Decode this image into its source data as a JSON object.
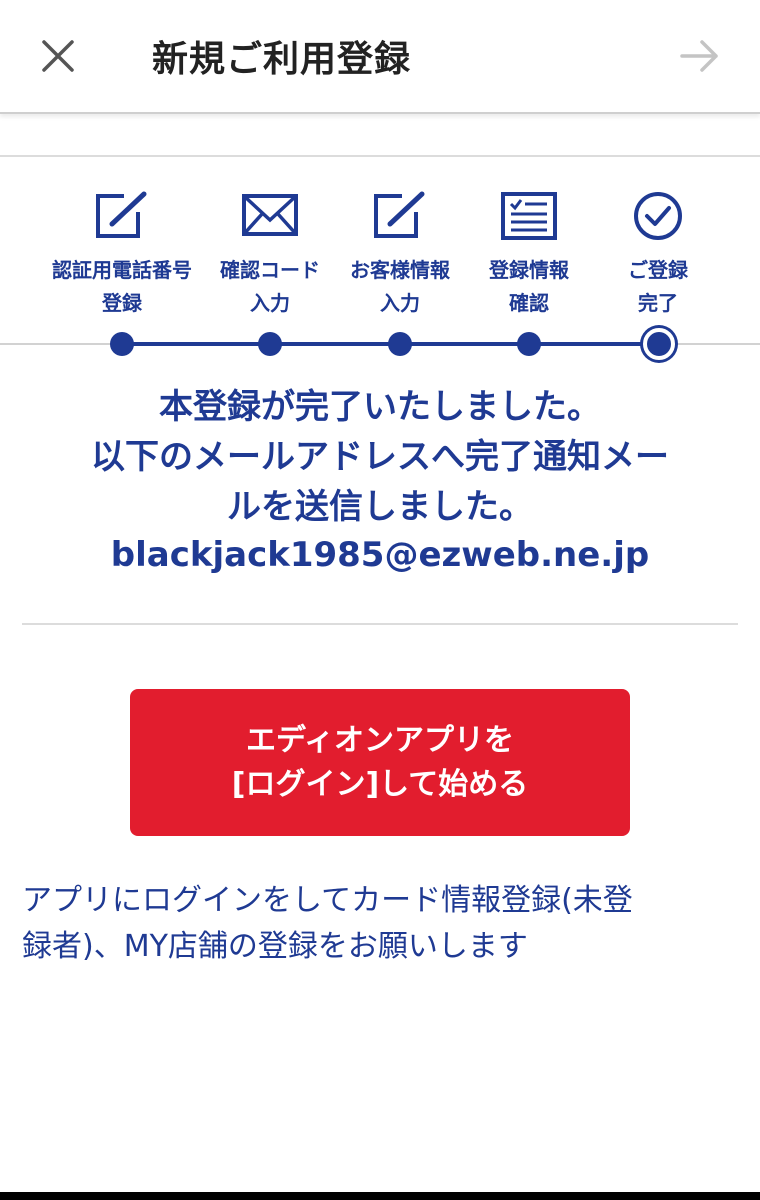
{
  "header": {
    "title": "新規ご利用登録",
    "close_icon": "close-icon",
    "next_icon": "arrow-right-icon"
  },
  "steps": [
    {
      "icon": "edit-icon",
      "line1": "認証用電話番号",
      "line2": "登録"
    },
    {
      "icon": "mail-icon",
      "line1": "確認コード",
      "line2": "入力"
    },
    {
      "icon": "edit-icon",
      "line1": "お客様情報",
      "line2": "入力"
    },
    {
      "icon": "form-icon",
      "line1": "登録情報",
      "line2": "確認"
    },
    {
      "icon": "check-circle-icon",
      "line1": "ご登録",
      "line2": "完了"
    }
  ],
  "current_step": 5,
  "message": {
    "line1": "本登録が完了いたしました。",
    "line2": "以下のメールアドレスへ完了通知メー",
    "line3": "ルを送信しました。",
    "email": "blackjack1985@ezweb.ne.jp"
  },
  "cta": {
    "line1": "エディオンアプリを",
    "line2": "[ログイン]して始める"
  },
  "note": {
    "line1": "アプリにログインをしてカード情報登録(未登",
    "line2": "録者)、MY店舗の登録をお願いします"
  },
  "colors": {
    "brand_blue": "#1f3a93",
    "cta_red": "#e21d2e",
    "divider": "#dcdcdc"
  }
}
